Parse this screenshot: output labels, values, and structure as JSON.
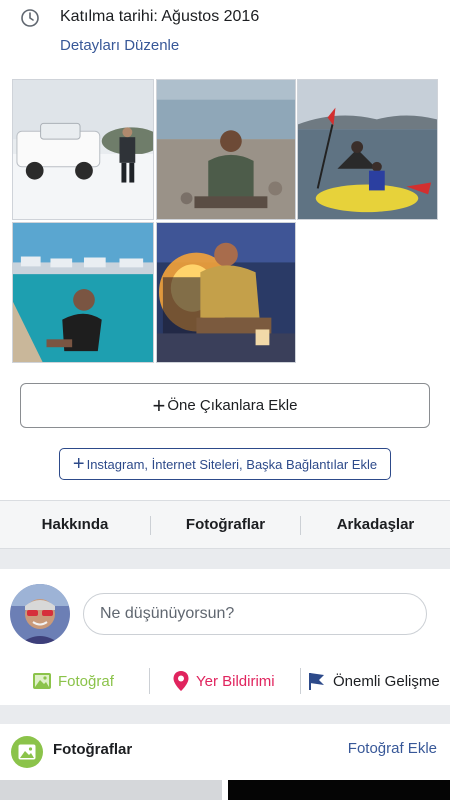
{
  "intro": {
    "icon": "clock-icon",
    "joined_text": "Katılma tarihi: Ağustos 2016",
    "edit_details": "Detayları Düzenle"
  },
  "photos": [
    {
      "name": "photo-white-pickup-snow"
    },
    {
      "name": "photo-man-on-pebble-beach"
    },
    {
      "name": "photo-kayak-on-sea"
    },
    {
      "name": "photo-man-by-marina"
    },
    {
      "name": "photo-man-by-campfire"
    }
  ],
  "buttons": {
    "featured": "Öne Çıkanlara Ekle",
    "links": "Instagram, İnternet Siteleri, Başka Bağlantılar Ekle",
    "plus": "+"
  },
  "tabs": [
    "Hakkında",
    "Fotoğraflar",
    "Arkadaşlar"
  ],
  "composer": {
    "placeholder": "Ne düşünüyorsun?"
  },
  "actions": [
    {
      "label": "Fotoğraf",
      "color": "#8bc34a",
      "icon": "photo-icon"
    },
    {
      "label": "Yer Bildirimi",
      "color": "#e0245e",
      "icon": "location-pin-icon"
    },
    {
      "label": "Önemli Gelişme",
      "color": "#1c1e21",
      "icon": "flag-icon"
    }
  ],
  "photos_section": {
    "title": "Fotoğraflar",
    "add_label": "Fotoğraf Ekle"
  },
  "colors": {
    "link": "#385898",
    "divider": "#e9ebee"
  }
}
